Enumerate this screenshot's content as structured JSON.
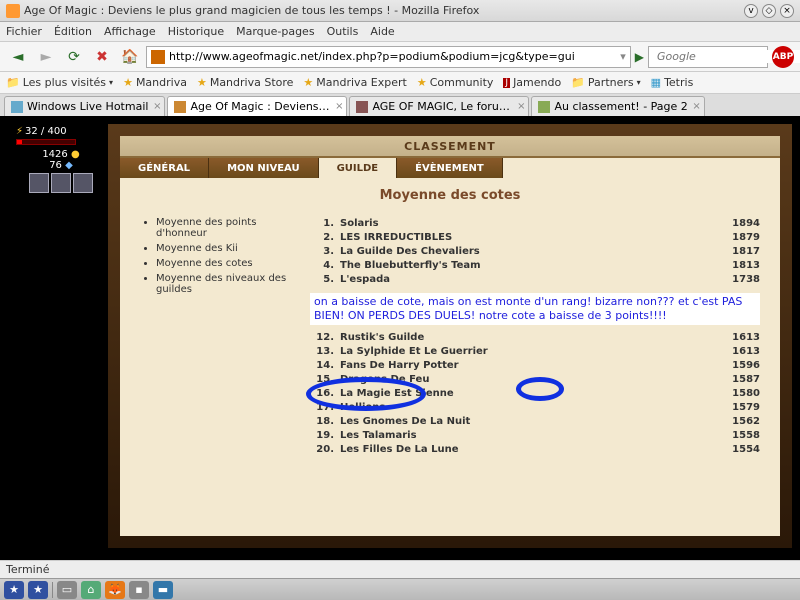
{
  "window": {
    "title": "Age Of Magic : Deviens le plus grand magicien de tous les temps ! - Mozilla Firefox"
  },
  "menu": [
    "Fichier",
    "Édition",
    "Affichage",
    "Historique",
    "Marque-pages",
    "Outils",
    "Aide"
  ],
  "nav": {
    "url": "http://www.ageofmagic.net/index.php?p=podium&podium=jcg&type=gui",
    "search_placeholder": "Google"
  },
  "bookmarks": [
    {
      "label": "Les plus visités",
      "type": "folder"
    },
    {
      "label": "Mandriva",
      "type": "star"
    },
    {
      "label": "Mandriva Store",
      "type": "star"
    },
    {
      "label": "Mandriva Expert",
      "type": "star"
    },
    {
      "label": "Community",
      "type": "star"
    },
    {
      "label": "Jamendo",
      "type": "icon"
    },
    {
      "label": "Partners",
      "type": "folder"
    },
    {
      "label": "Tetris",
      "type": "icon"
    }
  ],
  "tabs": [
    {
      "label": "Windows Live Hotmail",
      "active": false
    },
    {
      "label": "Age Of Magic : Deviens le ...",
      "active": true
    },
    {
      "label": "AGE OF MAGIC, Le forum o...",
      "active": false
    },
    {
      "label": "Au classement! - Page 2",
      "active": false
    }
  ],
  "stats": {
    "mana": "32 / 400",
    "gold": "1426",
    "crystal": "76"
  },
  "panel": {
    "header": "CLASSEMENT",
    "tabs": [
      "GÉNÉRAL",
      "MON NIVEAU",
      "GUILDE",
      "ÉVÈNEMENT"
    ],
    "active_tab": "GUILDE",
    "title": "Moyenne des cotes",
    "sidemenu": [
      "Moyenne des points d'honneur",
      "Moyenne des Kii",
      "Moyenne des cotes",
      "Moyenne des niveaux des guildes"
    ],
    "ranking_top": [
      {
        "rank": "1.",
        "name": "Solaris",
        "value": "1894"
      },
      {
        "rank": "2.",
        "name": "LES IRREDUCTIBLES",
        "value": "1879"
      },
      {
        "rank": "3.",
        "name": "La Guilde Des Chevaliers",
        "value": "1817"
      },
      {
        "rank": "4.",
        "name": "The Bluebutterfly's Team",
        "value": "1813"
      },
      {
        "rank": "5.",
        "name": "L'espada",
        "value": "1738"
      }
    ],
    "annotation": "on a baisse de cote, mais on est monte d'un rang! bizarre non??? et c'est PAS BIEN! ON PERDS DES DUELS! notre cote a baisse de 3 points!!!!",
    "ranking_bottom": [
      {
        "rank": "12.",
        "name": "Rustik's Guilde",
        "value": "1613"
      },
      {
        "rank": "13.",
        "name": "La Sylphide Et Le Guerrier",
        "value": "1613"
      },
      {
        "rank": "14.",
        "name": "Fans De Harry Potter",
        "value": "1596"
      },
      {
        "rank": "15.",
        "name": "Dragons De Feu",
        "value": "1587"
      },
      {
        "rank": "16.",
        "name": "La Magie Est Sienne",
        "value": "1580"
      },
      {
        "rank": "17.",
        "name": "Hellions",
        "value": "1579"
      },
      {
        "rank": "18.",
        "name": "Les Gnomes De La Nuit",
        "value": "1562"
      },
      {
        "rank": "19.",
        "name": "Les Talamaris",
        "value": "1558"
      },
      {
        "rank": "20.",
        "name": "Les Filles De La Lune",
        "value": "1554"
      }
    ]
  },
  "status": "Terminé"
}
